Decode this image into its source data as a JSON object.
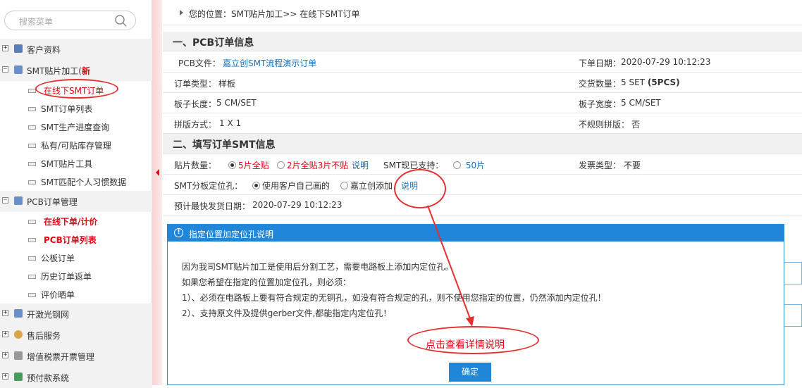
{
  "sidebar": {
    "search_placeholder": "搜索菜单",
    "groups": [
      {
        "label": "客户资料",
        "expanded": false
      },
      {
        "label": "SMT贴片加工(",
        "badge": "新",
        "expanded": true
      },
      {
        "label": "PCB订单管理",
        "expanded": true
      },
      {
        "label": "开激光钢网",
        "expanded": false
      },
      {
        "label": "售后服务",
        "expanded": false
      },
      {
        "label": "增值税票开票管理",
        "expanded": false
      },
      {
        "label": "预付款系统",
        "expanded": false
      }
    ],
    "smt_items": [
      "在线下SMT订单",
      "SMT订单列表",
      "SMT生产进度查询",
      "私有/可贴库存管理",
      "SMT贴片工具",
      "SMT匹配个人习惯数据"
    ],
    "pcb_items": [
      "在线下单/计价",
      "PCB订单列表",
      "公板订单",
      "历史订单返单",
      "评价晒单"
    ]
  },
  "breadcrumb": "您的位置：SMT贴片加工>> 在线下SMT订单",
  "section1": {
    "title": "一、PCB订单信息",
    "pcb_file_label": "PCB文件：",
    "pcb_file_value": "嘉立创SMT流程演示订单",
    "order_date_label": "下单日期：",
    "order_date_value": "2020-07-29 10:12:23",
    "order_type_label": "订单类型：",
    "order_type_value": "样板",
    "qty_label": "交货数量：",
    "qty_value": "5 SET",
    "qty_pcs": "(5PCS)",
    "length_label": "板子长度：",
    "length_value": "5 CM/SET",
    "width_label": "板子宽度：",
    "width_value": "5 CM/SET",
    "panel_label": "拼版方式：",
    "panel_value": "1 X 1",
    "irregular_label": "不规则拼版：",
    "irregular_value": "否"
  },
  "section2": {
    "title": "二、填写订单SMT信息",
    "mount_qty_label": "贴片数量：",
    "mount_opt1": "5片全贴",
    "mount_opt2": "2片全贴3片不贴",
    "explain1": "说明",
    "smt_support_label": "SMT现已支持：",
    "smt_support_opt": "50片",
    "invoice_label": "发票类型：",
    "invoice_value": "不要",
    "locate_label": "SMT分板定位孔：",
    "locate_opt1": "使用客户自己画的",
    "locate_opt2": "嘉立创添加",
    "explain2": "说明",
    "ship_label": "预计最快发货日期：",
    "ship_value": "2020-07-29 10:12:23"
  },
  "dialog": {
    "title": "指定位置加定位孔说明",
    "line1": "因为我司SMT贴片加工是使用后分割工艺，需要电路板上添加内定位孔。",
    "line2": "如果您希望在指定的位置加定位孔，则必须：",
    "line3": "1）、必须在电路板上要有符合规定的无铜孔，如没有符合规定的孔，则不使用您指定的位置，仍然添加内定位孔！",
    "line4": "2）、支持原文件及提供gerber文件,都能指定内定位孔！",
    "ok_label": "确定"
  },
  "annotation": {
    "text": "点击查看详情说明",
    "color": "#e60012"
  },
  "colors": {
    "accent": "#1f86da",
    "red": "#e60012",
    "link": "#1a6fb8"
  }
}
